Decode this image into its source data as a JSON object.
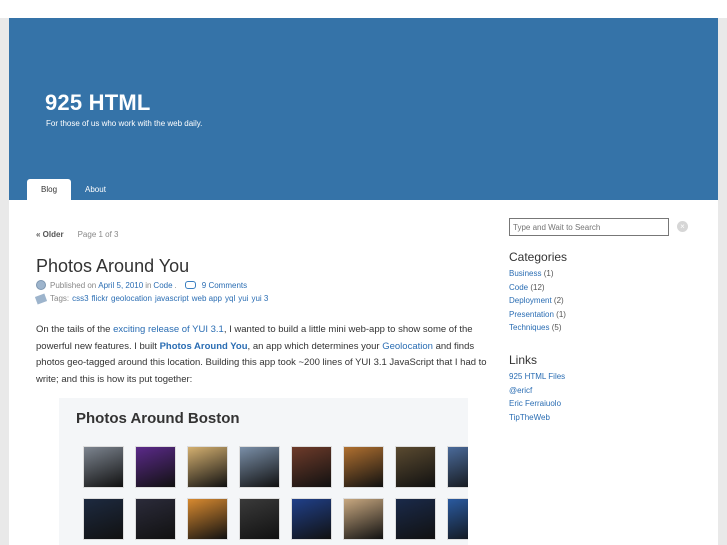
{
  "site": {
    "title": "925 HTML",
    "description": "For those of us who work with the web daily."
  },
  "nav": {
    "tabs": [
      {
        "label": "Blog",
        "active": true
      },
      {
        "label": "About",
        "active": false
      }
    ]
  },
  "pager": {
    "older": "« Older",
    "page_info": "Page 1 of 3"
  },
  "post": {
    "title": "Photos Around You",
    "published_prefix": "Published on",
    "date": "April 5, 2010",
    "in_word": "in",
    "category": "Code",
    "period": ".",
    "comments": "9 Comments",
    "tags_label": "Tags:",
    "tags": [
      "css3",
      "flickr",
      "geolocation",
      "javascript",
      "web app",
      "yql",
      "yui",
      "yui 3"
    ],
    "body": {
      "p1": "On the tails of the",
      "link1": "exciting release of YUI 3.1",
      "p2": ", I wanted to build a little mini web-app to show some of the powerful new features. I built",
      "link2": "Photos Around You",
      "p3": ", an app which determines your",
      "link3": "Geolocation",
      "p4": "and finds photos geo-tagged around this location. Building this app took ~200 lines of YUI 3.1 JavaScript that I had to write; and this is how its put together:"
    },
    "figure_title": "Photos Around Boston"
  },
  "sidebar": {
    "search_placeholder": "Type and Wait to Search",
    "clear_label": "×",
    "categories_heading": "Categories",
    "categories": [
      {
        "name": "Business",
        "count": "(1)"
      },
      {
        "name": "Code",
        "count": "(12)"
      },
      {
        "name": "Deployment",
        "count": "(2)"
      },
      {
        "name": "Presentation",
        "count": "(1)"
      },
      {
        "name": "Techniques",
        "count": "(5)"
      }
    ],
    "links_heading": "Links",
    "links": [
      "925 HTML Files",
      "@ericf",
      "Eric Ferraiuolo",
      "TipTheWeb"
    ]
  },
  "thumb_colors": [
    "#7d8590",
    "#5b2a8a",
    "#d4b070",
    "#7a8fa8",
    "#6e3b2a",
    "#b07030",
    "#5a4a30",
    "#4a6a9a",
    "#1d2a40",
    "#2b2b3a",
    "#d88a30",
    "#3a3a3a",
    "#20408a",
    "#c8a880",
    "#1a2a4a",
    "#2a5aa0"
  ]
}
